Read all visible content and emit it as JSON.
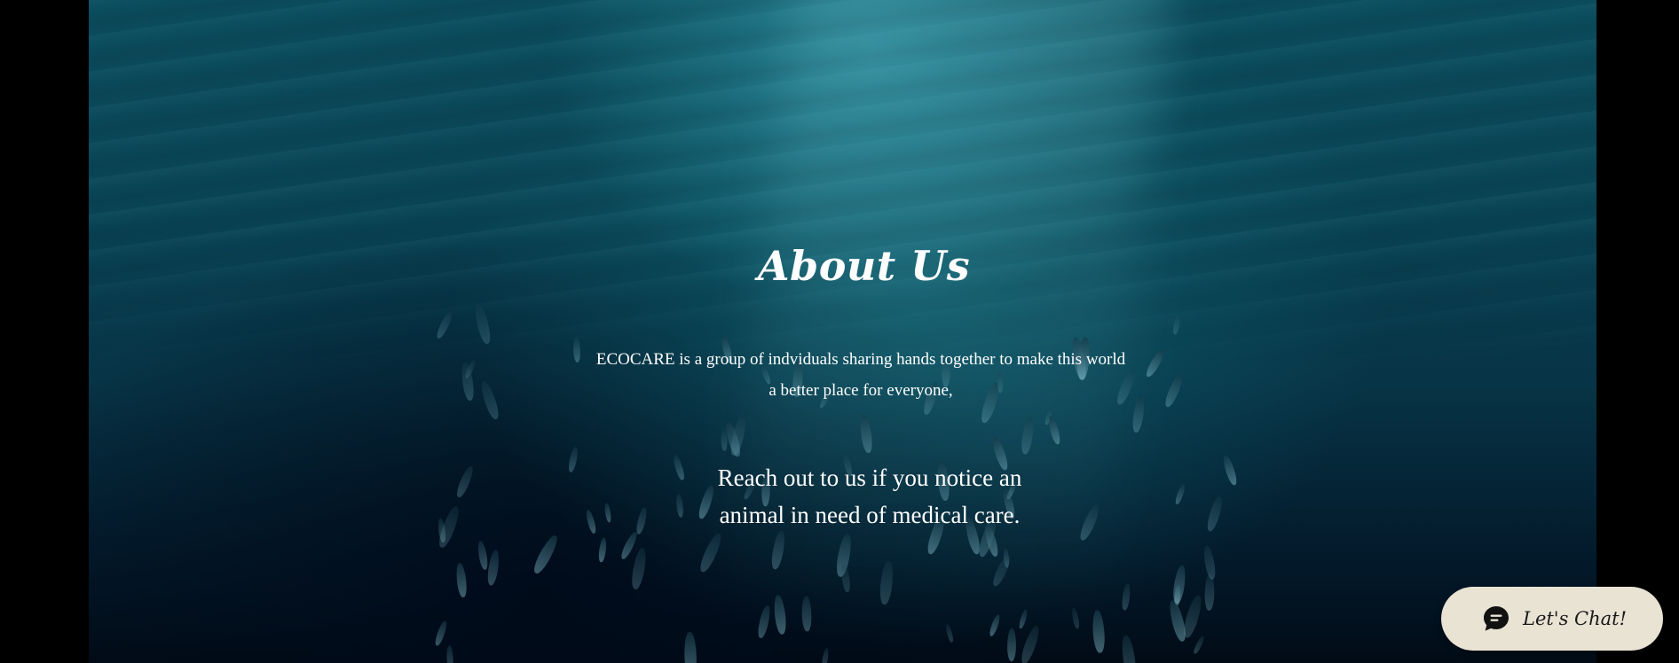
{
  "hero": {
    "title": "About Us",
    "intro_line1": "ECOCARE is a group of indviduals sharing hands together to make this world",
    "intro_line2": "a better place for everyone,",
    "cta_line1": "Reach out to us if you notice an",
    "cta_line2": "animal in need of medical care."
  },
  "chat_widget": {
    "label": "Let's Chat!",
    "icon": "chat-bubble-icon",
    "background": "#e9e3d4"
  },
  "colors": {
    "text": "#ffffff",
    "page_background": "#000000",
    "ocean": "#0a4556"
  }
}
